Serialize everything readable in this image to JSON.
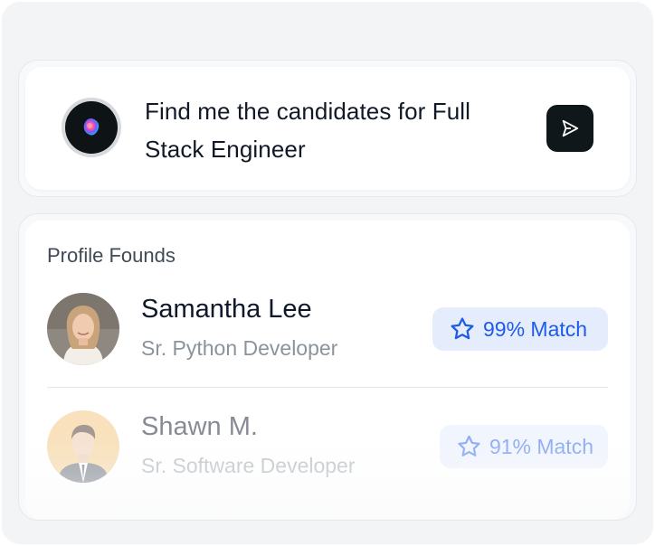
{
  "prompt": {
    "text": "Find me the candidates for Full Stack Engineer",
    "ai_icon": "ai-orb-icon",
    "send_icon": "send-icon"
  },
  "results": {
    "title": "Profile Founds",
    "profiles": [
      {
        "name": "Samantha Lee",
        "role": "Sr. Python Developer",
        "match": "99% Match",
        "match_icon": "star-icon"
      },
      {
        "name": "Shawn M.",
        "role": "Sr. Software Developer",
        "match": "91% Match",
        "match_icon": "star-icon"
      }
    ]
  },
  "colors": {
    "accent": "#1e5be6",
    "match_bg": "#e5edfd",
    "send_bg": "#0f171b"
  }
}
